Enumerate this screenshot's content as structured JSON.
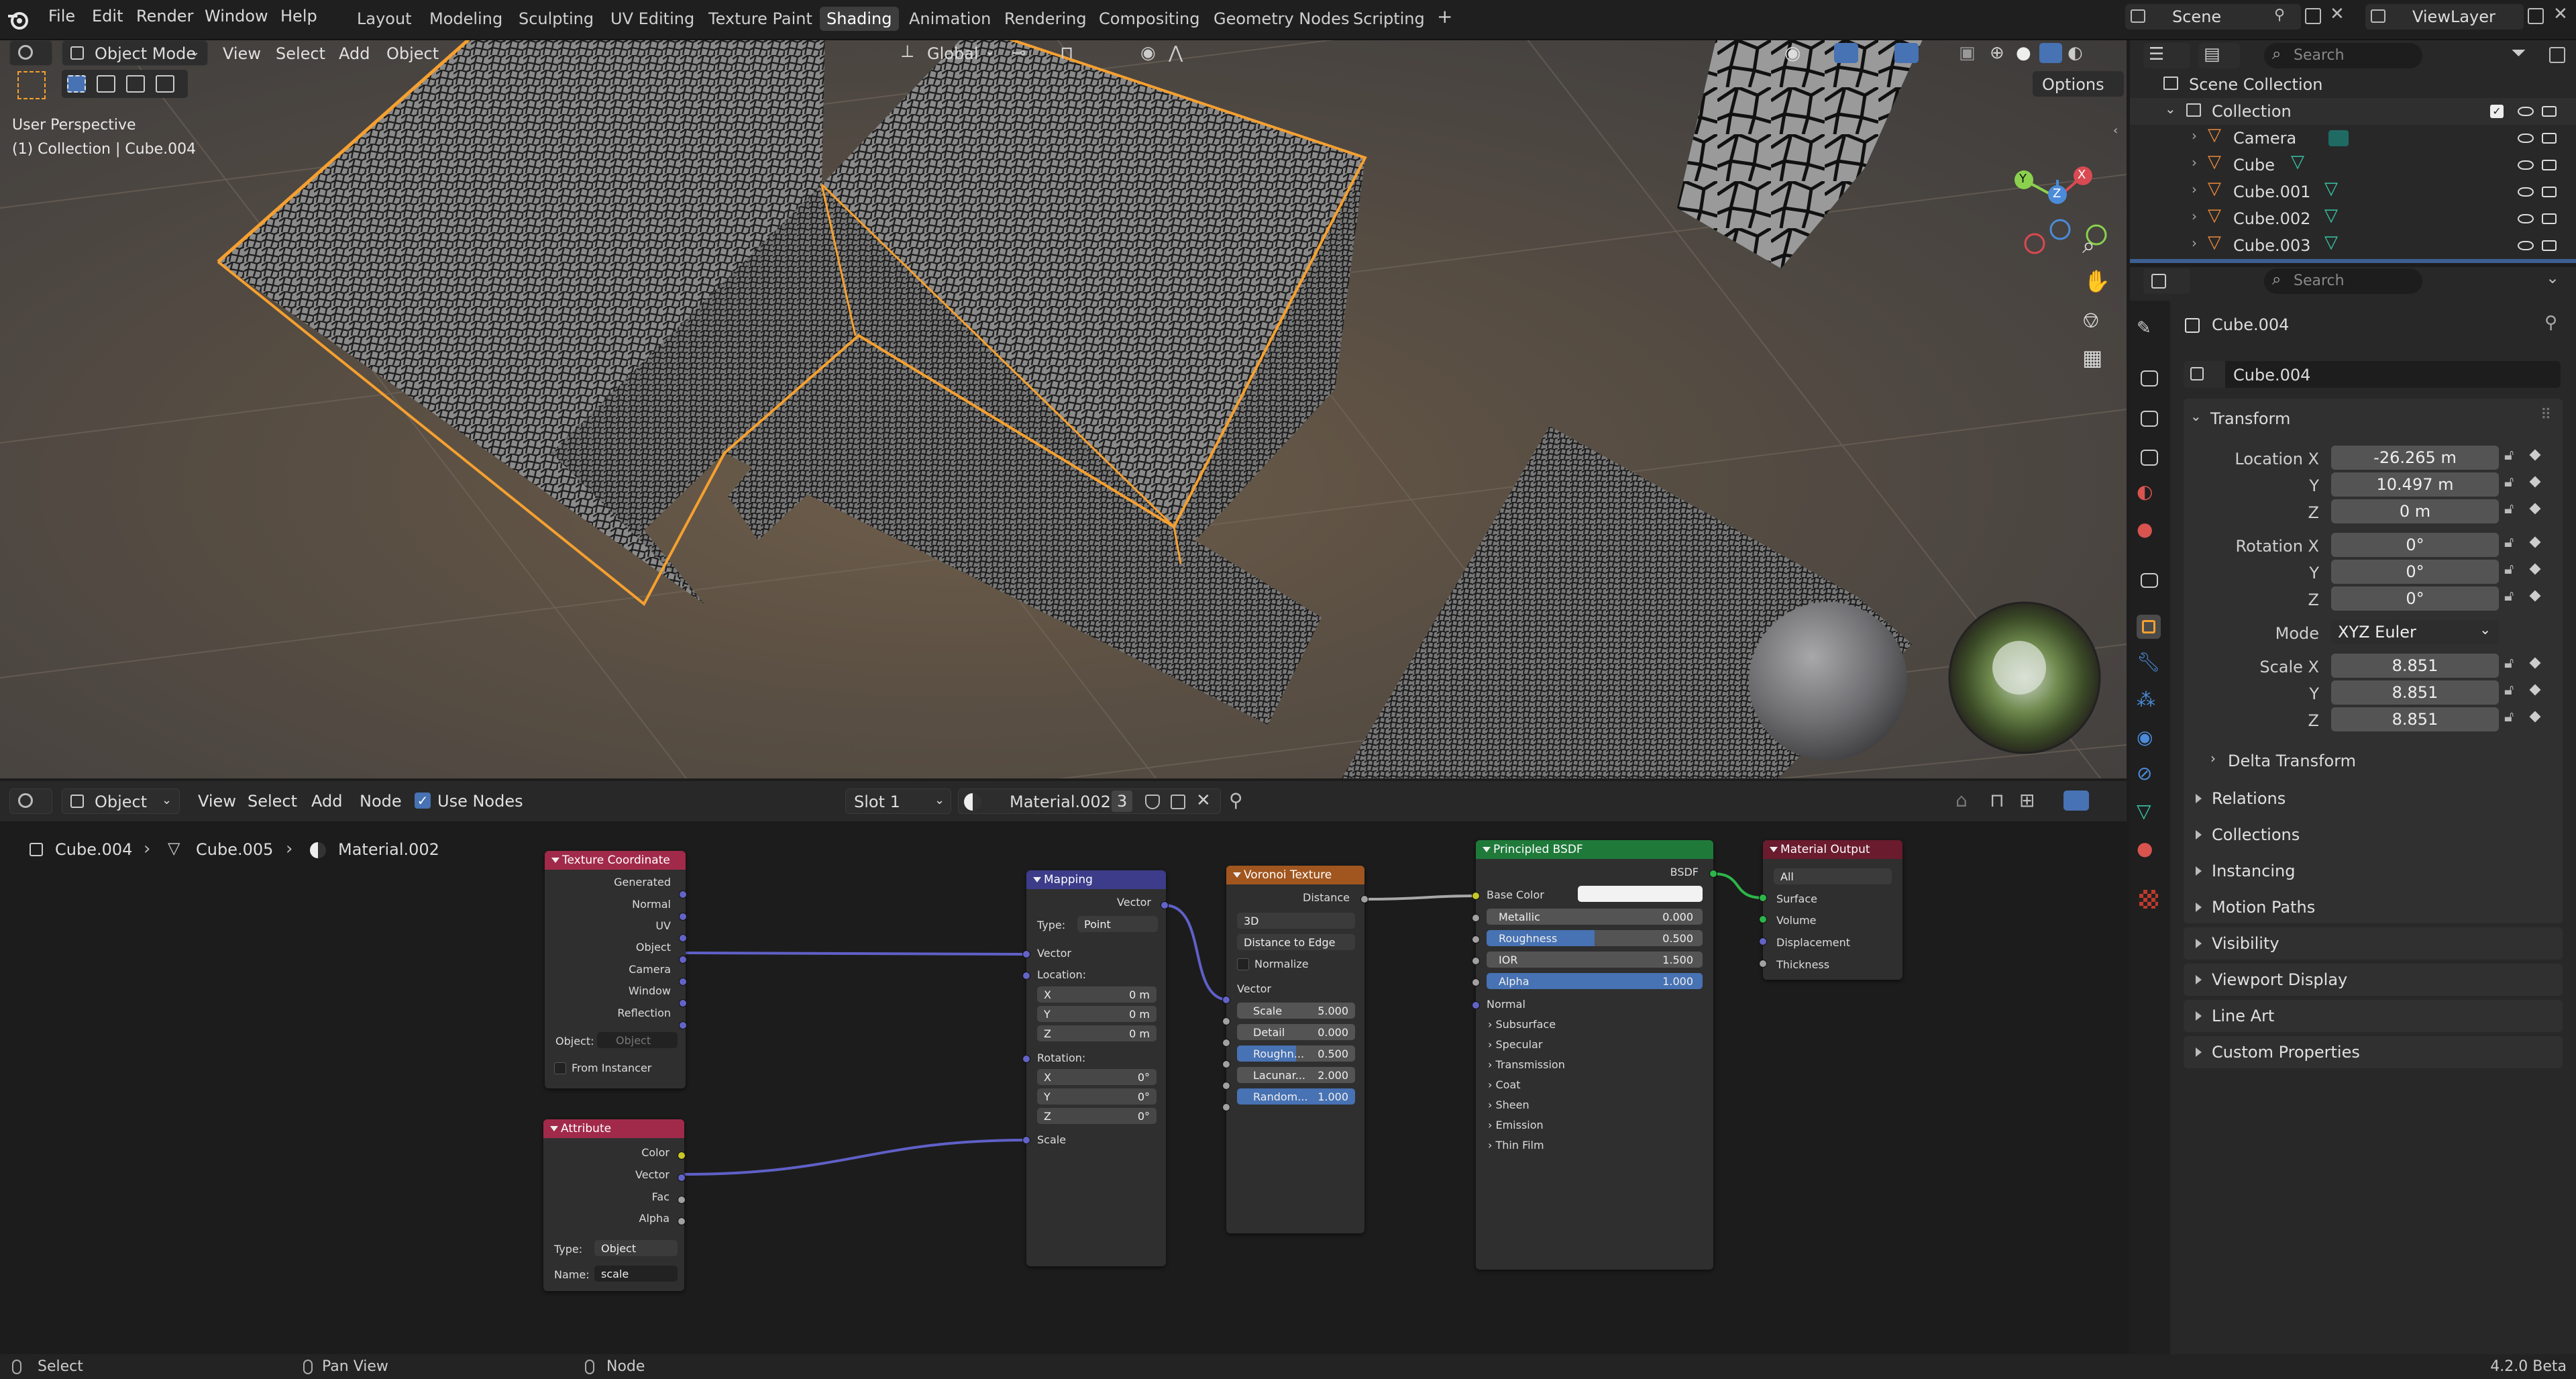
{
  "app_menu": [
    "File",
    "Edit",
    "Render",
    "Window",
    "Help"
  ],
  "workspaces": [
    "Layout",
    "Modeling",
    "Sculpting",
    "UV Editing",
    "Texture Paint",
    "Shading",
    "Animation",
    "Rendering",
    "Compositing",
    "Geometry Nodes",
    "Scripting"
  ],
  "active_workspace": "Shading",
  "add_workspace": "+",
  "scene": {
    "label": "Scene",
    "view_layer": "ViewLayer"
  },
  "viewport": {
    "mode": "Object Mode",
    "menus": [
      "View",
      "Select",
      "Add",
      "Object"
    ],
    "orientation": "Global",
    "options_label": "Options",
    "perspective": "User Perspective",
    "collection_info": "(1) Collection | Cube.004",
    "gizmo": {
      "x": "X",
      "y": "Y",
      "z": "Z"
    }
  },
  "node_editor": {
    "type": "Object",
    "menus": [
      "View",
      "Select",
      "Add",
      "Node"
    ],
    "use_nodes": "Use Nodes",
    "slot": "Slot 1",
    "material": "Material.002",
    "users": "3",
    "breadcrumb": [
      "Cube.004",
      "Cube.005",
      "Material.002"
    ],
    "nodes": {
      "texcoord": {
        "title": "Texture Coordinate",
        "outputs": [
          "Generated",
          "Normal",
          "UV",
          "Object",
          "Camera",
          "Window",
          "Reflection"
        ],
        "object_label": "Object:",
        "object_placeholder": "Object",
        "from_instancer": "From Instancer"
      },
      "attribute": {
        "title": "Attribute",
        "outputs": [
          "Color",
          "Vector",
          "Fac",
          "Alpha"
        ],
        "type_label": "Type:",
        "type_value": "Object",
        "name_label": "Name:",
        "name_value": "scale"
      },
      "mapping": {
        "title": "Mapping",
        "output": "Vector",
        "type_label": "Type:",
        "type_value": "Point",
        "vector": "Vector",
        "location": "Location:",
        "rotation": "Rotation:",
        "scale": "Scale",
        "loc": [
          {
            "k": "X",
            "v": "0 m"
          },
          {
            "k": "Y",
            "v": "0 m"
          },
          {
            "k": "Z",
            "v": "0 m"
          }
        ],
        "rot": [
          {
            "k": "X",
            "v": "0°"
          },
          {
            "k": "Y",
            "v": "0°"
          },
          {
            "k": "Z",
            "v": "0°"
          }
        ]
      },
      "voronoi": {
        "title": "Voronoi Texture",
        "output": "Distance",
        "dim": "3D",
        "feature": "Distance to Edge",
        "normalize": "Normalize",
        "vector": "Vector",
        "fields": [
          {
            "k": "Scale",
            "v": "5.000"
          },
          {
            "k": "Detail",
            "v": "0.000"
          },
          {
            "k": "Roughn...",
            "v": "0.500"
          },
          {
            "k": "Lacunar...",
            "v": "2.000"
          },
          {
            "k": "Random...",
            "v": "1.000"
          }
        ]
      },
      "bsdf": {
        "title": "Principled BSDF",
        "output": "BSDF",
        "base_color": "Base Color",
        "fields": [
          {
            "k": "Metallic",
            "v": "0.000"
          },
          {
            "k": "Roughness",
            "v": "0.500"
          },
          {
            "k": "IOR",
            "v": "1.500"
          },
          {
            "k": "Alpha",
            "v": "1.000"
          }
        ],
        "normal": "Normal",
        "panels": [
          "Subsurface",
          "Specular",
          "Transmission",
          "Coat",
          "Sheen",
          "Emission",
          "Thin Film"
        ]
      },
      "output": {
        "title": "Material Output",
        "target": "All",
        "inputs": [
          "Surface",
          "Volume",
          "Displacement",
          "Thickness"
        ]
      }
    }
  },
  "outliner": {
    "search_placeholder": "Search",
    "items": [
      {
        "name": "Scene Collection",
        "depth": 0
      },
      {
        "name": "Collection",
        "depth": 1
      },
      {
        "name": "Camera",
        "depth": 2
      },
      {
        "name": "Cube",
        "depth": 2
      },
      {
        "name": "Cube.001",
        "depth": 2
      },
      {
        "name": "Cube.002",
        "depth": 2
      },
      {
        "name": "Cube.003",
        "depth": 2
      }
    ]
  },
  "properties": {
    "search_placeholder": "Search",
    "object_name": "Cube.004",
    "object_name_field": "Cube.004",
    "transform_label": "Transform",
    "location_x_label": "Location X",
    "location": [
      "-26.265 m",
      "10.497 m",
      "0 m"
    ],
    "rotation_x_label": "Rotation X",
    "rotation": [
      "0°",
      "0°",
      "0°"
    ],
    "mode_label": "Mode",
    "mode_value": "XYZ Euler",
    "scale_x_label": "Scale X",
    "scale": [
      "8.851",
      "8.851",
      "8.851"
    ],
    "axis_y": "Y",
    "axis_z": "Z",
    "delta_transform": "Delta Transform",
    "sections": [
      "Relations",
      "Collections",
      "Instancing",
      "Motion Paths",
      "Visibility",
      "Viewport Display",
      "Line Art",
      "Custom Properties"
    ]
  },
  "status": {
    "select": "Select",
    "pan_view": "Pan View",
    "node": "Node",
    "version": "4.2.0 Beta"
  },
  "colors": {
    "accent": "#4772b3",
    "selection_outline": "#f5a030",
    "texcoord_header": "#a12a4a",
    "attribute_header": "#a12a4a",
    "mapping_header": "#3c3c8a",
    "voronoi_header": "#a0561e",
    "bsdf_header": "#1f7a3a",
    "output_header": "#6a1b2e"
  }
}
